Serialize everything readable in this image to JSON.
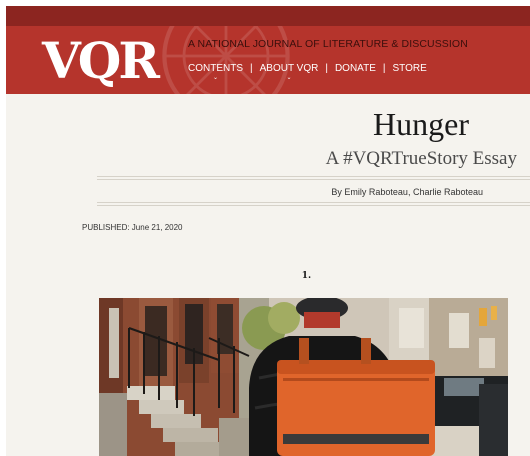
{
  "site": {
    "logo": "VQR",
    "tagline": "A NATIONAL JOURNAL OF LITERATURE & DISCUSSION",
    "nav": [
      "CONTENTS",
      "ABOUT VQR",
      "DONATE",
      "STORE"
    ],
    "nav_separator": "|",
    "brand_color": "#b5342c"
  },
  "article": {
    "title": "Hunger",
    "subtitle": "A #VQRTrueStory Essay",
    "byline": "By Emily Raboteau, Charlie Raboteau",
    "published": "PUBLISHED: June 21, 2020",
    "section_number": "1."
  },
  "icons": {
    "nav_chevron": "chevron-down-icon"
  }
}
